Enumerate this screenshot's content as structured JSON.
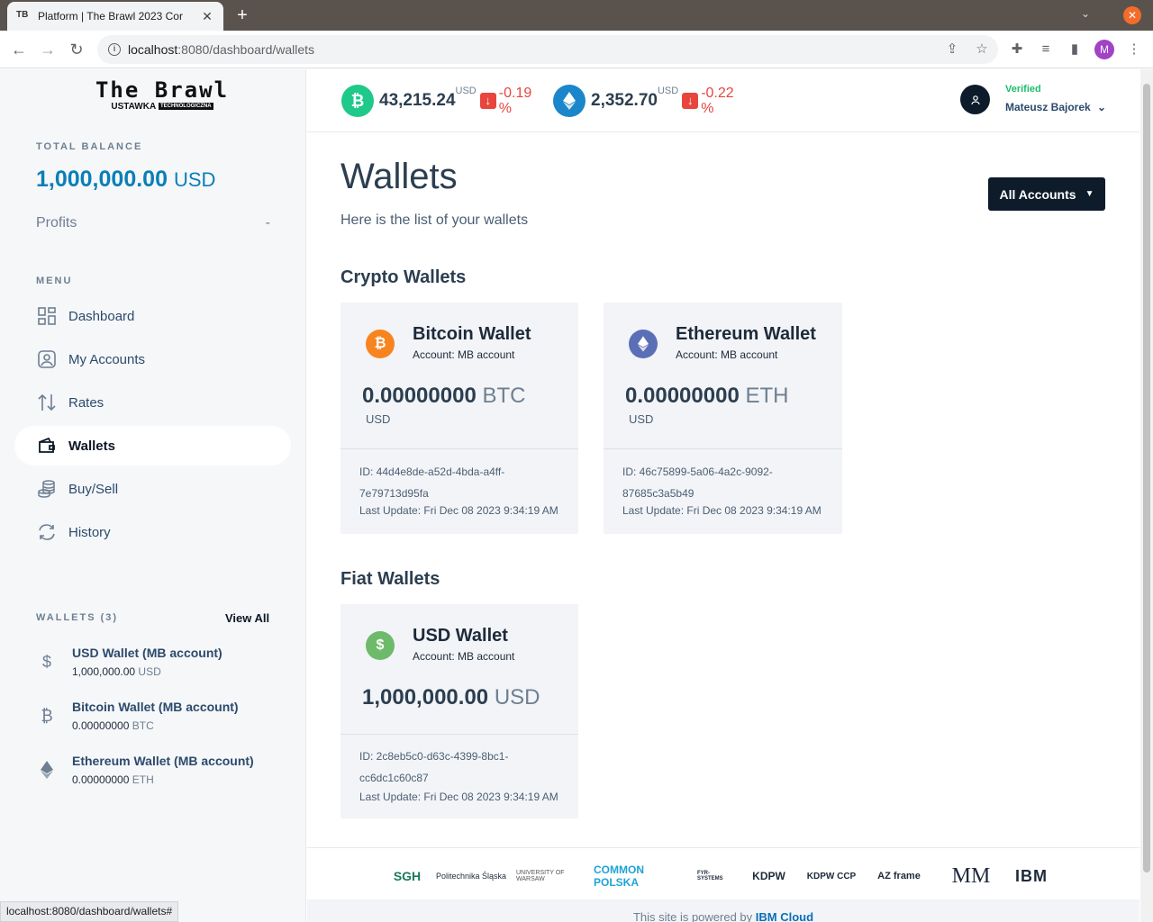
{
  "browser": {
    "tab_title": "Platform | The Brawl 2023 Cor",
    "favicon": "TB",
    "url_host": "localhost",
    "url_path": ":8080/dashboard/wallets",
    "profile_initial": "M",
    "status_url": "localhost:8080/dashboard/wallets#"
  },
  "logo": {
    "line1": "The Brawl",
    "line2": "USTAWKA",
    "line2_badge": "TECHNOLOGICZNA"
  },
  "sidebar": {
    "total_label": "TOTAL BALANCE",
    "total_amount": "1,000,000.00",
    "total_currency": "USD",
    "profits_label": "Profits",
    "profits_value": "-",
    "menu_label": "MENU",
    "menu": [
      {
        "label": "Dashboard",
        "icon": "dashboard-icon"
      },
      {
        "label": "My Accounts",
        "icon": "account-icon"
      },
      {
        "label": "Rates",
        "icon": "rates-icon"
      },
      {
        "label": "Wallets",
        "icon": "wallet-icon",
        "active": true
      },
      {
        "label": "Buy/Sell",
        "icon": "coins-icon"
      },
      {
        "label": "History",
        "icon": "history-icon"
      }
    ],
    "wallets_label": "WALLETS (3)",
    "view_all": "View All",
    "wallets": [
      {
        "name": "USD Wallet (MB account)",
        "amount": "1,000,000.00",
        "currency": "USD",
        "icon": "dollar-icon"
      },
      {
        "name": "Bitcoin Wallet (MB account)",
        "amount": "0.00000000",
        "currency": "BTC",
        "icon": "bitcoin-icon"
      },
      {
        "name": "Ethereum Wallet (MB account)",
        "amount": "0.00000000",
        "currency": "ETH",
        "icon": "ethereum-icon"
      }
    ]
  },
  "header": {
    "rates": [
      {
        "price": "43,215.24",
        "unit": "USD",
        "change": "-0.19 %",
        "color": "#1ec98a",
        "icon": "bitcoin-icon"
      },
      {
        "price": "2,352.70",
        "unit": "USD",
        "change": "-0.22 %",
        "color": "#1b86c9",
        "icon": "ethereum-icon"
      }
    ],
    "verified": "Verified",
    "user_name": "Mateusz Bajorek"
  },
  "main": {
    "title": "Wallets",
    "subtitle": "Here is the list of your wallets",
    "accounts_button": "All Accounts",
    "crypto_title": "Crypto Wallets",
    "fiat_title": "Fiat Wallets",
    "cards": [
      {
        "title": "Bitcoin Wallet",
        "account": "Account: MB account",
        "amount": "0.00000000",
        "currency": "BTC",
        "usd_label": "USD",
        "id": "ID: 44d4e8de-a52d-4bda-a4ff-7e79713d95fa",
        "updated": "Last Update: Fri Dec 08 2023 9:34:19 AM",
        "color": "#f7841f",
        "icon": "bitcoin-icon"
      },
      {
        "title": "Ethereum Wallet",
        "account": "Account: MB account",
        "amount": "0.00000000",
        "currency": "ETH",
        "usd_label": "USD",
        "id": "ID: 46c75899-5a06-4a2c-9092-87685c3a5b49",
        "updated": "Last Update: Fri Dec 08 2023 9:34:19 AM",
        "color": "#5a6fb6",
        "icon": "ethereum-icon"
      },
      {
        "title": "USD Wallet",
        "account": "Account: MB account",
        "amount": "1,000,000.00",
        "currency": "USD",
        "id": "ID: 2c8eb5c0-d63c-4399-8bc1-cc6dc1c60c87",
        "updated": "Last Update: Fri Dec 08 2023 9:34:19 AM",
        "color": "#6dbb6a",
        "icon": "dollar-icon"
      }
    ]
  },
  "footer": {
    "sponsors": [
      "SGH",
      "Politechnika Śląska",
      "UNIVERSITY OF WARSAW",
      "COMMON POLSKA",
      "FYR-SYSTEMS",
      "KDPW",
      "KDPW CCP",
      "AZ frame",
      "MM",
      "IBM"
    ],
    "powered_prefix": "This site is powered by",
    "powered_brand": "IBM Cloud"
  }
}
